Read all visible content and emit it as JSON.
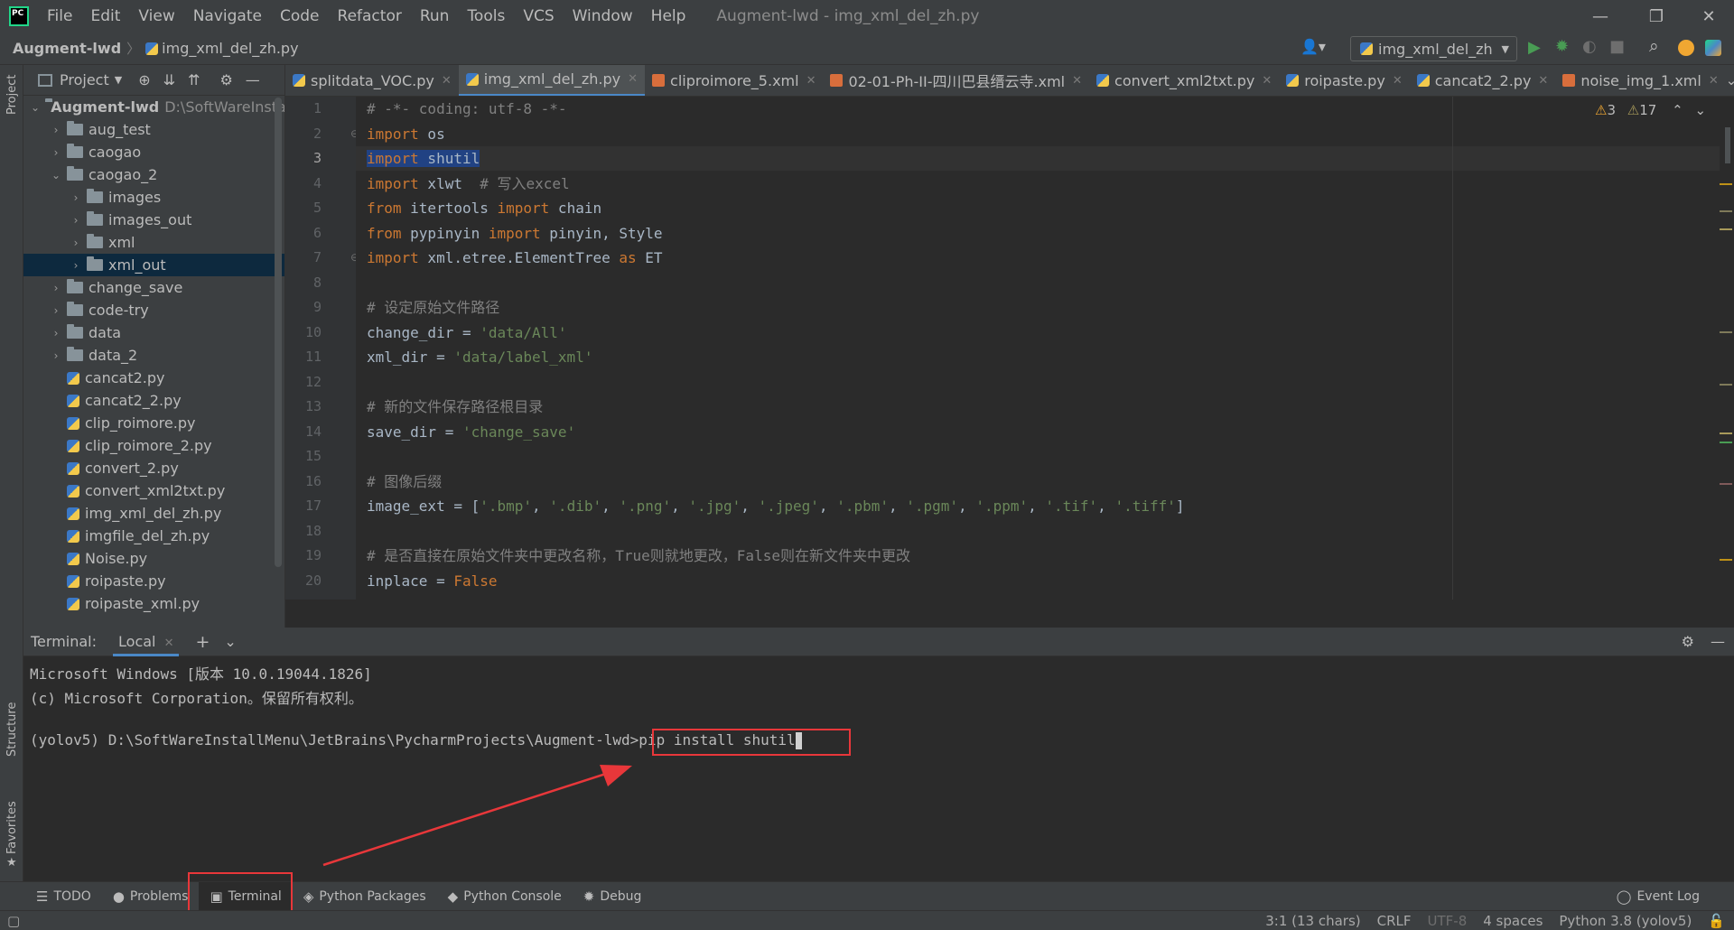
{
  "menubar": {
    "items": [
      "File",
      "Edit",
      "View",
      "Navigate",
      "Code",
      "Refactor",
      "Run",
      "Tools",
      "VCS",
      "Window",
      "Help"
    ],
    "title": "Augment-lwd - img_xml_del_zh.py"
  },
  "navbar": {
    "project": "Augment-lwd",
    "file": "img_xml_del_zh.py",
    "run_config": "img_xml_del_zh"
  },
  "left_strip": {
    "project": "Project",
    "structure": "Structure",
    "favorites": "Favorites"
  },
  "project_panel": {
    "title": "Project",
    "root": {
      "name": "Augment-lwd",
      "path": "D:\\SoftWareInsta"
    },
    "items": [
      {
        "label": "aug_test",
        "type": "folder",
        "level": 1,
        "expanded": false
      },
      {
        "label": "caogao",
        "type": "folder",
        "level": 1,
        "expanded": false
      },
      {
        "label": "caogao_2",
        "type": "folder",
        "level": 1,
        "expanded": true
      },
      {
        "label": "images",
        "type": "folder",
        "level": 2,
        "expanded": false
      },
      {
        "label": "images_out",
        "type": "folder",
        "level": 2,
        "expanded": false
      },
      {
        "label": "xml",
        "type": "folder",
        "level": 2,
        "expanded": false
      },
      {
        "label": "xml_out",
        "type": "folder",
        "level": 2,
        "expanded": false,
        "selected": true
      },
      {
        "label": "change_save",
        "type": "folder",
        "level": 1,
        "expanded": false
      },
      {
        "label": "code-try",
        "type": "folder",
        "level": 1,
        "expanded": false
      },
      {
        "label": "data",
        "type": "folder",
        "level": 1,
        "expanded": false
      },
      {
        "label": "data_2",
        "type": "folder",
        "level": 1,
        "expanded": false
      },
      {
        "label": "cancat2.py",
        "type": "file",
        "level": 1
      },
      {
        "label": "cancat2_2.py",
        "type": "file",
        "level": 1
      },
      {
        "label": "clip_roimore.py",
        "type": "file",
        "level": 1
      },
      {
        "label": "clip_roimore_2.py",
        "type": "file",
        "level": 1
      },
      {
        "label": "convert_2.py",
        "type": "file",
        "level": 1
      },
      {
        "label": "convert_xml2txt.py",
        "type": "file",
        "level": 1
      },
      {
        "label": "img_xml_del_zh.py",
        "type": "file",
        "level": 1
      },
      {
        "label": "imgfile_del_zh.py",
        "type": "file",
        "level": 1
      },
      {
        "label": "Noise.py",
        "type": "file",
        "level": 1
      },
      {
        "label": "roipaste.py",
        "type": "file",
        "level": 1
      },
      {
        "label": "roipaste_xml.py",
        "type": "file",
        "level": 1
      }
    ]
  },
  "tabs": [
    {
      "label": "splitdata_VOC.py",
      "kind": "py"
    },
    {
      "label": "img_xml_del_zh.py",
      "kind": "py",
      "active": true
    },
    {
      "label": "cliproimore_5.xml",
      "kind": "xml"
    },
    {
      "label": "02-01-Ph-II-四川巴县缙云寺.xml",
      "kind": "xml"
    },
    {
      "label": "convert_xml2txt.py",
      "kind": "py"
    },
    {
      "label": "roipaste.py",
      "kind": "py"
    },
    {
      "label": "cancat2_2.py",
      "kind": "py"
    },
    {
      "label": "noise_img_1.xml",
      "kind": "xml"
    }
  ],
  "inspections": {
    "warnings": "3",
    "weak_warnings": "17"
  },
  "editor": {
    "current_line": 3,
    "lines": [
      [
        [
          "cm",
          "# -*- coding: utf-8 -*-"
        ]
      ],
      [
        [
          "kw",
          "import"
        ],
        [
          "",
          " os"
        ]
      ],
      [
        [
          "kw sel",
          "import"
        ],
        [
          "sel",
          " shutil"
        ]
      ],
      [
        [
          "kw",
          "import"
        ],
        [
          "",
          " xlwt  "
        ],
        [
          "cm",
          "# 写入excel"
        ]
      ],
      [
        [
          "kw",
          "from"
        ],
        [
          "",
          " itertools "
        ],
        [
          "kw",
          "import"
        ],
        [
          "",
          " chain"
        ]
      ],
      [
        [
          "kw",
          "from"
        ],
        [
          "",
          " pypinyin "
        ],
        [
          "kw",
          "import"
        ],
        [
          "",
          " pinyin, Style"
        ]
      ],
      [
        [
          "kw",
          "import"
        ],
        [
          "",
          " xml.etree.ElementTree "
        ],
        [
          "kw",
          "as"
        ],
        [
          "",
          " ET"
        ]
      ],
      [
        [
          "",
          ""
        ]
      ],
      [
        [
          "cm",
          "# 设定原始文件路径"
        ]
      ],
      [
        [
          "",
          "change_dir = "
        ],
        [
          "st",
          "'data/All'"
        ]
      ],
      [
        [
          "",
          "xml_dir = "
        ],
        [
          "st",
          "'data/label_xml'"
        ]
      ],
      [
        [
          "",
          ""
        ]
      ],
      [
        [
          "cm",
          "# 新的文件保存路径根目录"
        ]
      ],
      [
        [
          "",
          "save_dir = "
        ],
        [
          "st",
          "'change_save'"
        ]
      ],
      [
        [
          "",
          ""
        ]
      ],
      [
        [
          "cm",
          "# 图像后缀"
        ]
      ],
      [
        [
          "",
          "image_ext = ["
        ],
        [
          "st",
          "'.bmp'"
        ],
        [
          "",
          ", "
        ],
        [
          "st",
          "'.dib'"
        ],
        [
          "",
          ", "
        ],
        [
          "st",
          "'.png'"
        ],
        [
          "",
          ", "
        ],
        [
          "st",
          "'.jpg'"
        ],
        [
          "",
          ", "
        ],
        [
          "st",
          "'.jpeg'"
        ],
        [
          "",
          ", "
        ],
        [
          "st",
          "'.pbm'"
        ],
        [
          "",
          ", "
        ],
        [
          "st",
          "'.pgm'"
        ],
        [
          "",
          ", "
        ],
        [
          "st",
          "'.ppm'"
        ],
        [
          "",
          ", "
        ],
        [
          "st",
          "'.tif'"
        ],
        [
          "",
          ", "
        ],
        [
          "st",
          "'.tiff'"
        ],
        [
          "",
          "]"
        ]
      ],
      [
        [
          "",
          ""
        ]
      ],
      [
        [
          "cm",
          "# 是否直接在原始文件夹中更改名称，True则就地更改，False则在新文件夹中更改"
        ]
      ],
      [
        [
          "",
          "inplace = "
        ],
        [
          "kw",
          "False"
        ]
      ]
    ]
  },
  "terminal": {
    "label": "Terminal:",
    "tab": "Local",
    "lines": [
      "Microsoft Windows [版本 10.0.19044.1826]",
      "(c) Microsoft Corporation。保留所有权利。",
      ""
    ],
    "prompt": "(yolov5) D:\\SoftWareInstallMenu\\JetBrains\\PycharmProjects\\Augment-lwd>",
    "command": "pip install shutil"
  },
  "toolbar": {
    "items": [
      {
        "label": "TODO",
        "icon": "list-icon"
      },
      {
        "label": "Problems",
        "icon": "info-icon"
      },
      {
        "label": "Terminal",
        "icon": "terminal-icon",
        "active": true
      },
      {
        "label": "Python Packages",
        "icon": "layers-icon"
      },
      {
        "label": "Python Console",
        "icon": "python-icon"
      },
      {
        "label": "Debug",
        "icon": "bug-icon"
      }
    ],
    "event_log": "Event Log"
  },
  "statusbar": {
    "position": "3:1 (13 chars)",
    "line_sep": "CRLF",
    "encoding": "UTF-8",
    "indent": "4 spaces",
    "interpreter": "Python 3.8 (yolov5)"
  },
  "colors": {
    "highlight_red": "#e8373a",
    "accent_blue": "#4a88c7",
    "keyword": "#cc7832",
    "string": "#6a8759"
  }
}
